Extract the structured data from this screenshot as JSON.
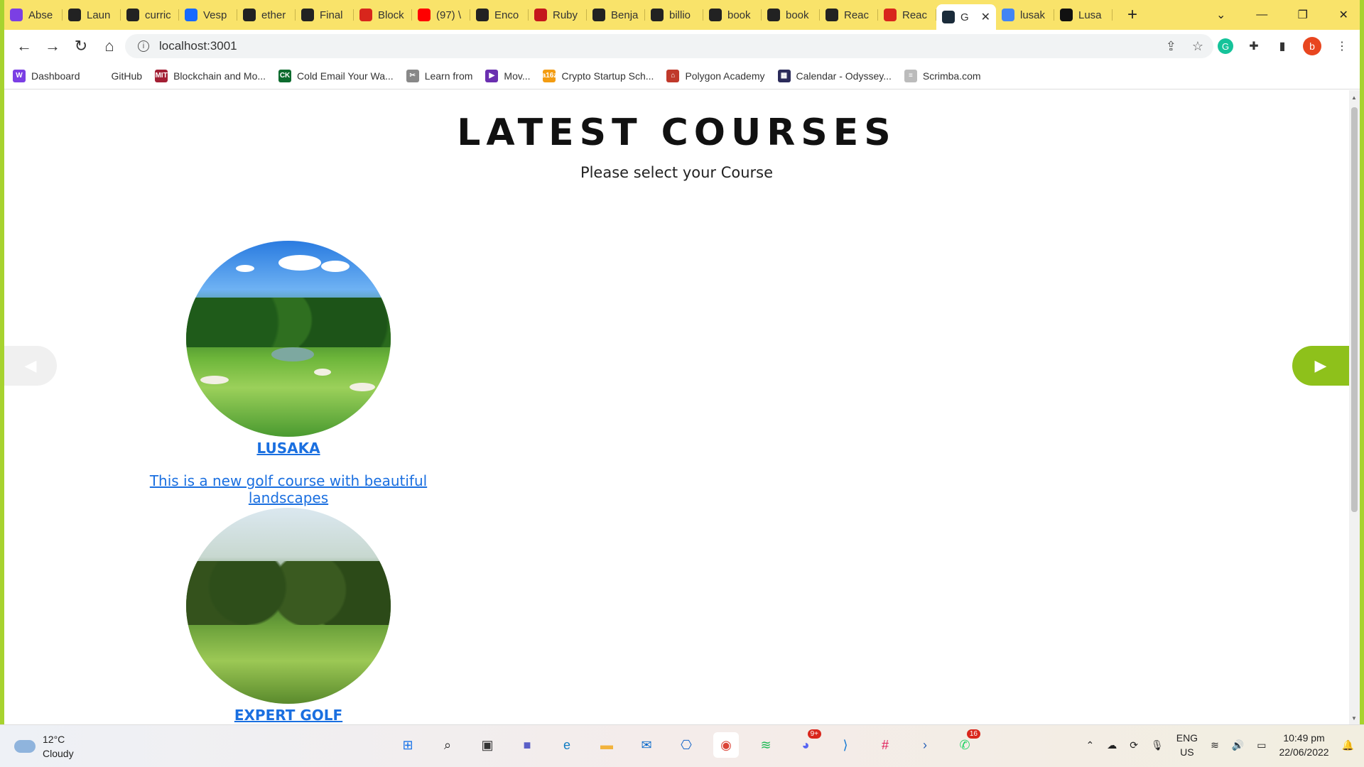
{
  "browser": {
    "tabs": [
      {
        "label": "Abse",
        "color": "#7b3fe4"
      },
      {
        "label": "Laun",
        "color": "#222222"
      },
      {
        "label": "curric",
        "color": "#222222"
      },
      {
        "label": "Vesp",
        "color": "#1769ff"
      },
      {
        "label": "ether",
        "color": "#222222"
      },
      {
        "label": "Final",
        "color": "#222222"
      },
      {
        "label": "Block",
        "color": "#d8261c"
      },
      {
        "label": "(97) \\",
        "color": "#ff0000"
      },
      {
        "label": "Enco",
        "color": "#222222"
      },
      {
        "label": "Ruby",
        "color": "#c4181c"
      },
      {
        "label": "Benja",
        "color": "#222222"
      },
      {
        "label": "billio",
        "color": "#222222"
      },
      {
        "label": "book",
        "color": "#222222"
      },
      {
        "label": "book",
        "color": "#222222"
      },
      {
        "label": "Reac",
        "color": "#222222"
      },
      {
        "label": "Reac",
        "color": "#d8261c"
      },
      {
        "label": "G",
        "color": "#1a2b3a",
        "active": true
      },
      {
        "label": "lusak",
        "color": "#4285f4"
      },
      {
        "label": "Lusa",
        "color": "#111111"
      }
    ],
    "new_tab": "+",
    "window_controls": {
      "minimize": "—",
      "restore": "❐",
      "close": "✕",
      "tab_search": "⌄"
    },
    "url": "localhost:3001",
    "avatar_letter": "b",
    "bookmarks": [
      {
        "label": "Dashboard",
        "color": "#7b3fe4",
        "icon": "W"
      },
      {
        "label": "GitHub",
        "color": "#ffffff",
        "icon": ""
      },
      {
        "label": "Blockchain and Mo...",
        "color": "#a31f34",
        "icon": "MIT"
      },
      {
        "label": "Cold Email Your Wa...",
        "color": "#0d6b2e",
        "icon": "CK"
      },
      {
        "label": "Learn from",
        "color": "#888888",
        "icon": "✂"
      },
      {
        "label": "Mov...",
        "color": "#6a2fb0",
        "icon": "▶"
      },
      {
        "label": "Crypto Startup Sch...",
        "color": "#f39c12",
        "icon": "a16z"
      },
      {
        "label": "Polygon Academy",
        "color": "#c0392b",
        "icon": "⌂"
      },
      {
        "label": "Calendar - Odyssey...",
        "color": "#2b2b5a",
        "icon": "▦"
      },
      {
        "label": "Scrimba.com",
        "color": "#bbbbbb",
        "icon": "≡"
      }
    ]
  },
  "page": {
    "title": "LATEST COURSES",
    "subtitle": "Please select your Course",
    "courses": [
      {
        "name": "LUSAKA",
        "description": "This is a new golf course with beautiful landscapes"
      },
      {
        "name": "EXPERT GOLF",
        "description": ""
      }
    ],
    "accent_color": "#8ec11b",
    "link_color": "#1a6fe0"
  },
  "taskbar": {
    "weather_temp": "12°C",
    "weather_desc": "Cloudy",
    "lang": "ENG",
    "region": "US",
    "time": "10:49 pm",
    "date": "22/06/2022",
    "apps": [
      {
        "name": "start",
        "color": "#1a73e8",
        "glyph": "⊞"
      },
      {
        "name": "search",
        "color": "#222222",
        "glyph": "⌕"
      },
      {
        "name": "task-view",
        "color": "#333333",
        "glyph": "▣"
      },
      {
        "name": "teams",
        "color": "#5b5fc7",
        "glyph": "■"
      },
      {
        "name": "edge",
        "color": "#0f7cc2",
        "glyph": "e"
      },
      {
        "name": "file-explorer",
        "color": "#f2b33d",
        "glyph": "▬"
      },
      {
        "name": "mail",
        "color": "#0b6bcb",
        "glyph": "✉"
      },
      {
        "name": "store",
        "color": "#1767c9",
        "glyph": "⎔"
      },
      {
        "name": "chrome",
        "color": "#db4437",
        "glyph": "◉",
        "active": true
      },
      {
        "name": "spotify",
        "color": "#1db954",
        "glyph": "≋"
      },
      {
        "name": "discord",
        "color": "#5865f2",
        "glyph": "◕",
        "badge": "9+"
      },
      {
        "name": "vscode",
        "color": "#1177d3",
        "glyph": "⟩"
      },
      {
        "name": "slack",
        "color": "#e01e5a",
        "glyph": "#"
      },
      {
        "name": "powershell",
        "color": "#2a62b7",
        "glyph": "›"
      },
      {
        "name": "whatsapp",
        "color": "#25d366",
        "glyph": "✆",
        "badge": "16"
      }
    ]
  }
}
